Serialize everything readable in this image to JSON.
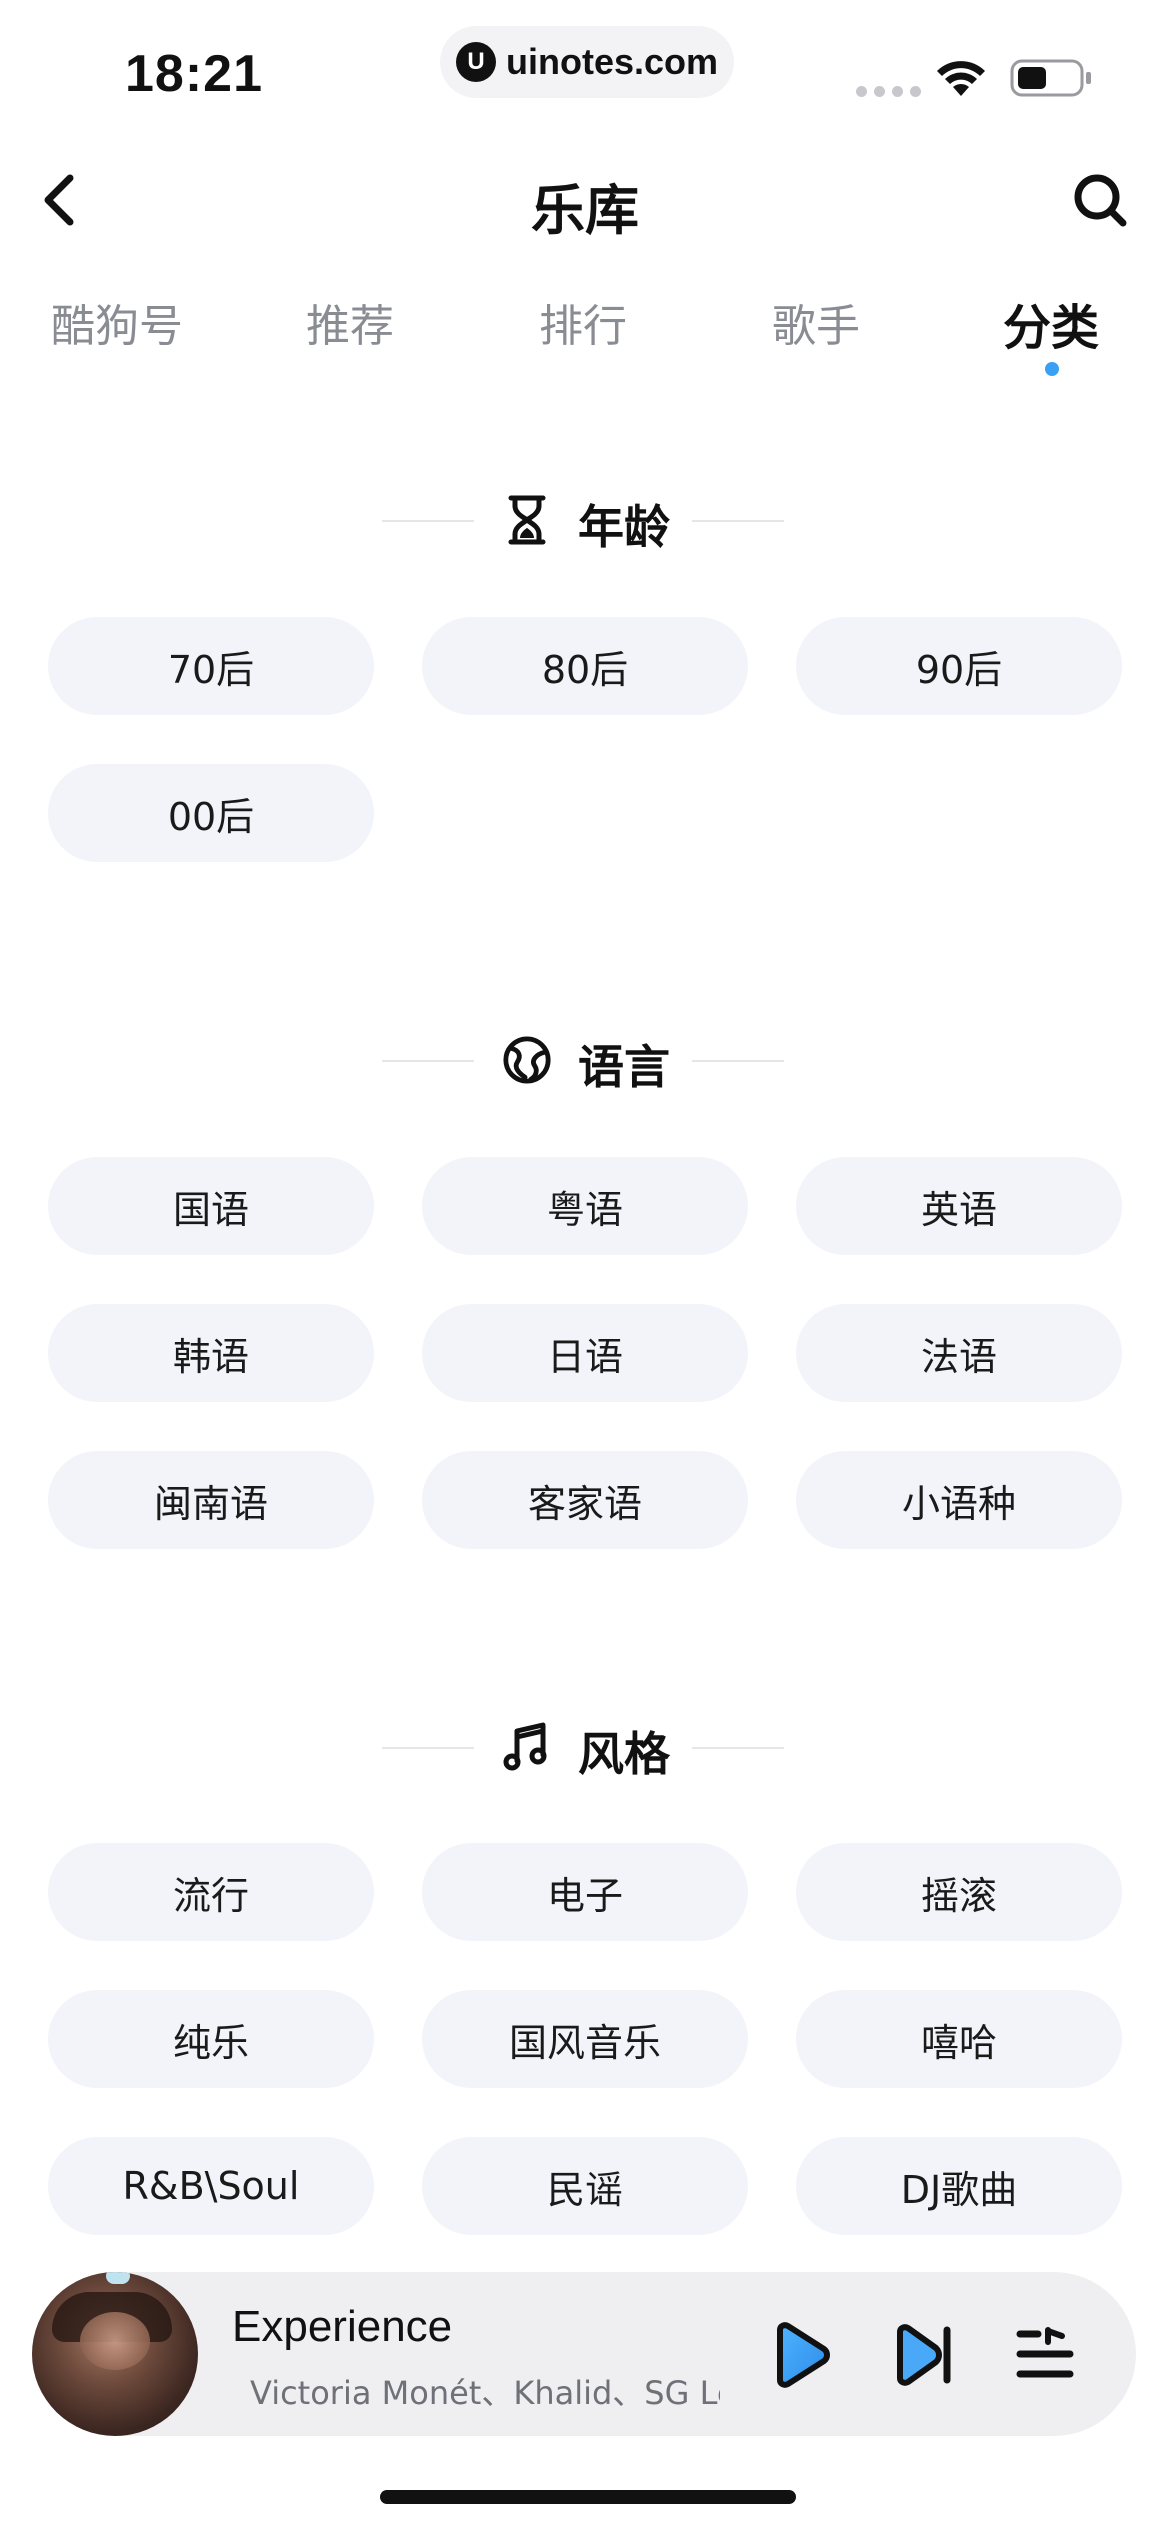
{
  "status_bar": {
    "time": "18:21",
    "url": "uinotes.com",
    "url_logo": "U"
  },
  "header": {
    "title": "乐库",
    "back_icon": "chevron-left-icon",
    "search_icon": "search-icon"
  },
  "tabs": [
    {
      "label": "酷狗号",
      "active": false
    },
    {
      "label": "推荐",
      "active": false
    },
    {
      "label": "排行",
      "active": false
    },
    {
      "label": "歌手",
      "active": false
    },
    {
      "label": "分类",
      "active": true
    }
  ],
  "sections": [
    {
      "title": "年龄",
      "icon": "hourglass-icon",
      "items": [
        "70后",
        "80后",
        "90后",
        "00后"
      ]
    },
    {
      "title": "语言",
      "icon": "globe-icon",
      "items": [
        "国语",
        "粤语",
        "英语",
        "韩语",
        "日语",
        "法语",
        "闽南语",
        "客家语",
        "小语种"
      ]
    },
    {
      "title": "风格",
      "icon": "music-note-icon",
      "items": [
        "流行",
        "电子",
        "摇滚",
        "纯乐",
        "国风音乐",
        "嘻哈",
        "R&B\\Soul",
        "民谣",
        "DJ歌曲"
      ]
    }
  ],
  "player": {
    "title": "Experience",
    "artist": "Victoria Monét、Khalid、SG Lewis",
    "play_icon": "play-icon",
    "next_icon": "skip-next-icon",
    "playlist_icon": "playlist-icon"
  },
  "colors": {
    "accent": "#3aa0f5",
    "chip_bg": "#f3f4fa",
    "player_bg": "#efeff1",
    "tab_inactive": "#8a8c94"
  }
}
